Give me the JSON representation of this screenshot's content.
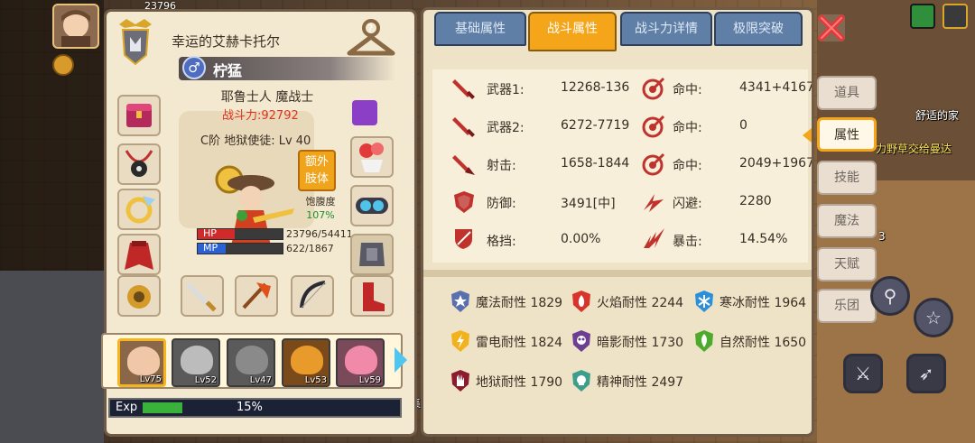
{
  "background": {
    "top_value": "23796",
    "npc_name": "舒适的家",
    "quest_text": "力野草交给曼达",
    "misc_text": "3",
    "bottom_text": "收集"
  },
  "character": {
    "title": "幸运的艾赫卡托尔",
    "class": "柠猛",
    "gender_symbol": "♂",
    "race_class": "耶鲁士人 魔战士",
    "power": "战斗力:92792",
    "rank_level": "C阶 地狱使徒: Lv 40",
    "extra_limb": [
      "额外",
      "肢体"
    ],
    "satiety_label": "饱腹度",
    "satiety_value": "107%",
    "hp_label": "HP",
    "hp_value": "23796/54411",
    "hp_fraction": 0.437,
    "mp_label": "MP",
    "mp_value": "622/1867",
    "mp_fraction": 0.333
  },
  "companions": [
    {
      "level": "Lv75",
      "selected": true
    },
    {
      "level": "Lv52",
      "selected": false
    },
    {
      "level": "Lv47",
      "selected": false
    },
    {
      "level": "Lv53",
      "selected": false
    },
    {
      "level": "Lv59",
      "selected": false
    }
  ],
  "exp": {
    "label": "Exp",
    "percent": "15%",
    "fraction": 0.15
  },
  "tabs": [
    {
      "label": "基础属性",
      "active": false
    },
    {
      "label": "战斗属性",
      "active": true
    },
    {
      "label": "战斗力详情",
      "active": false
    },
    {
      "label": "极限突破",
      "active": false
    }
  ],
  "combat_stats": {
    "weapon1": {
      "label": "武器1:",
      "value": "12268-136"
    },
    "hit1": {
      "label": "命中:",
      "value": "4341+4167"
    },
    "weapon2": {
      "label": "武器2:",
      "value": "6272-7719"
    },
    "hit2": {
      "label": "命中:",
      "value": "0"
    },
    "shoot": {
      "label": "射击:",
      "value": "1658-1844"
    },
    "hit3": {
      "label": "命中:",
      "value": "2049+1967"
    },
    "defense": {
      "label": "防御:",
      "value": "3491[中]"
    },
    "evade": {
      "label": "闪避:",
      "value": "2280"
    },
    "block": {
      "label": "格挡:",
      "value": "0.00%"
    },
    "crit": {
      "label": "暴击:",
      "value": "14.54%"
    }
  },
  "resistances": [
    {
      "text": "魔法耐性 1829",
      "icon": "magic-resist-icon",
      "color": "#5a6fae"
    },
    {
      "text": "火焰耐性 2244",
      "icon": "fire-resist-icon",
      "color": "#d9342b"
    },
    {
      "text": "寒冰耐性 1964",
      "icon": "ice-resist-icon",
      "color": "#2c8fd9"
    },
    {
      "text": "雷电耐性 1824",
      "icon": "lightning-resist-icon",
      "color": "#f2b21d"
    },
    {
      "text": "暗影耐性 1730",
      "icon": "shadow-resist-icon",
      "color": "#6d3f93"
    },
    {
      "text": "自然耐性 1650",
      "icon": "nature-resist-icon",
      "color": "#4daa2c"
    },
    {
      "text": "地狱耐性 1790",
      "icon": "hell-resist-icon",
      "color": "#8a1c2b"
    },
    {
      "text": "精神耐性 2497",
      "icon": "spirit-resist-icon",
      "color": "#3e9e8c"
    }
  ],
  "side_menu": [
    {
      "label": "道具",
      "active": false
    },
    {
      "label": "属性",
      "active": true
    },
    {
      "label": "技能",
      "active": false
    },
    {
      "label": "魔法",
      "active": false
    },
    {
      "label": "天赋",
      "active": false
    },
    {
      "label": "乐团",
      "active": false
    }
  ],
  "colors": {
    "accent": "#f4a51a",
    "tab_blue": "#5f7fa7",
    "power_red": "#e0321e",
    "hp": "#d12a2a",
    "mp": "#2a62d6",
    "exp": "#39b13a"
  }
}
